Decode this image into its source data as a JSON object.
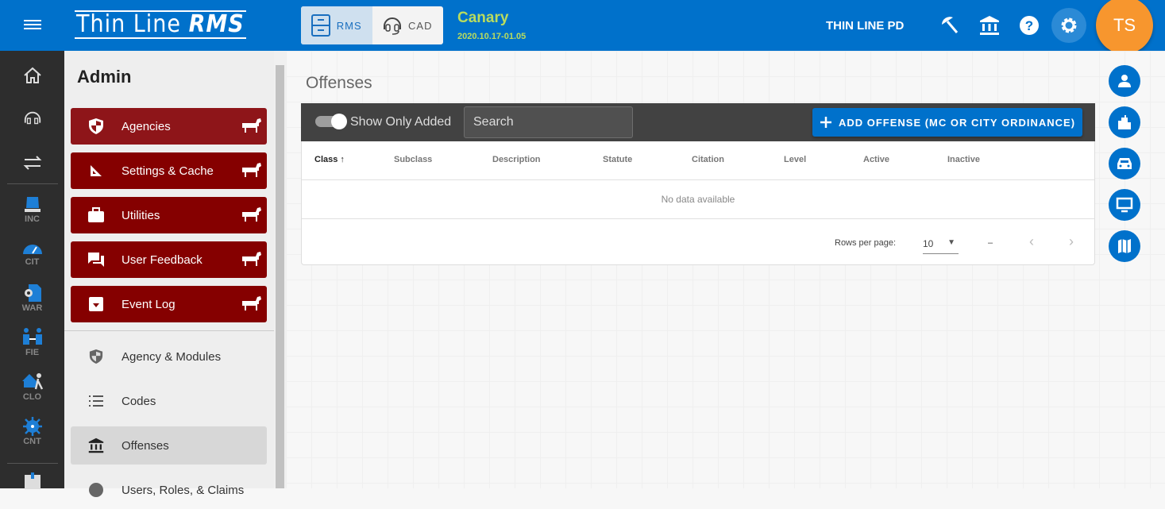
{
  "header": {
    "logo_text": "Thin Line RMS",
    "modules": [
      {
        "label": "RMS",
        "icon": "file-cabinet-icon",
        "active": true
      },
      {
        "label": "CAD",
        "icon": "headset-icon",
        "active": false
      }
    ],
    "environment": "Canary",
    "version": "2020.10.17-01.05",
    "agency": "THIN LINE PD",
    "user_initials": "TS"
  },
  "rail": {
    "items": [
      {
        "label": "INC"
      },
      {
        "label": "CIT"
      },
      {
        "label": "WAR"
      },
      {
        "label": "FIE"
      },
      {
        "label": "CLO"
      },
      {
        "label": "CNT"
      }
    ]
  },
  "admin": {
    "title": "Admin",
    "red_items": [
      {
        "label": "Agencies"
      },
      {
        "label": "Settings & Cache"
      },
      {
        "label": "Utilities"
      },
      {
        "label": "User Feedback"
      },
      {
        "label": "Event Log"
      }
    ],
    "items": [
      {
        "label": "Agency & Modules"
      },
      {
        "label": "Codes"
      },
      {
        "label": "Offenses",
        "selected": true
      },
      {
        "label": "Users, Roles, & Claims"
      }
    ]
  },
  "main": {
    "title": "Offenses",
    "toggle_label": "Show Only Added",
    "toggle_on": true,
    "search_placeholder": "Search",
    "add_button": "ADD OFFENSE (MC OR CITY ORDINANCE)",
    "columns": [
      "Class",
      "Subclass",
      "Description",
      "Statute",
      "Citation",
      "Level",
      "Active",
      "Inactive"
    ],
    "empty_text": "No data available",
    "rows_per_page_label": "Rows per page:",
    "rows_per_page": "10",
    "page_range": "–"
  },
  "colors": {
    "primary": "#0071cb",
    "admin_red": "#850000",
    "avatar": "#f7962e",
    "env": "#b9dc5e"
  }
}
